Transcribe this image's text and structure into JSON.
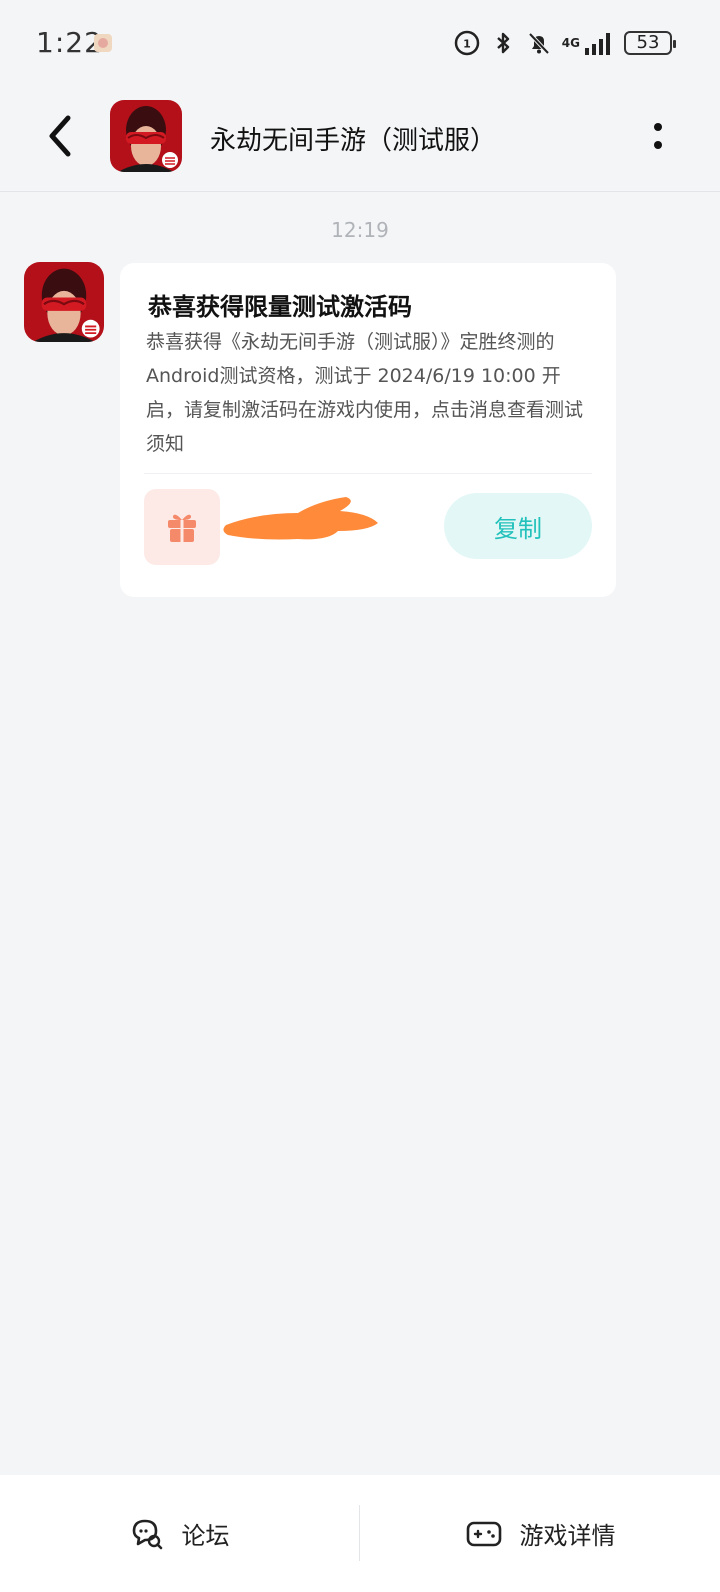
{
  "status_bar": {
    "time": "1:22",
    "network": "4G",
    "battery": "53"
  },
  "header": {
    "title": "永劫无间手游（测试服）"
  },
  "chat": {
    "timestamp": "12:19",
    "card": {
      "title": "恭喜获得限量测试激活码",
      "body": "恭喜获得《永劫无间手游（测试服）》定胜终测的Android测试资格，测试于 2024/6/19 10:00 开启，请复制激活码在游戏内使用，点击消息查看测试须知",
      "copy_label": "复制"
    }
  },
  "bottom_nav": {
    "forum_label": "论坛",
    "game_detail_label": "游戏详情"
  },
  "colors": {
    "accent": "#22c1bb",
    "gift": "#f58a6b",
    "redaction": "#ff8a3a"
  }
}
